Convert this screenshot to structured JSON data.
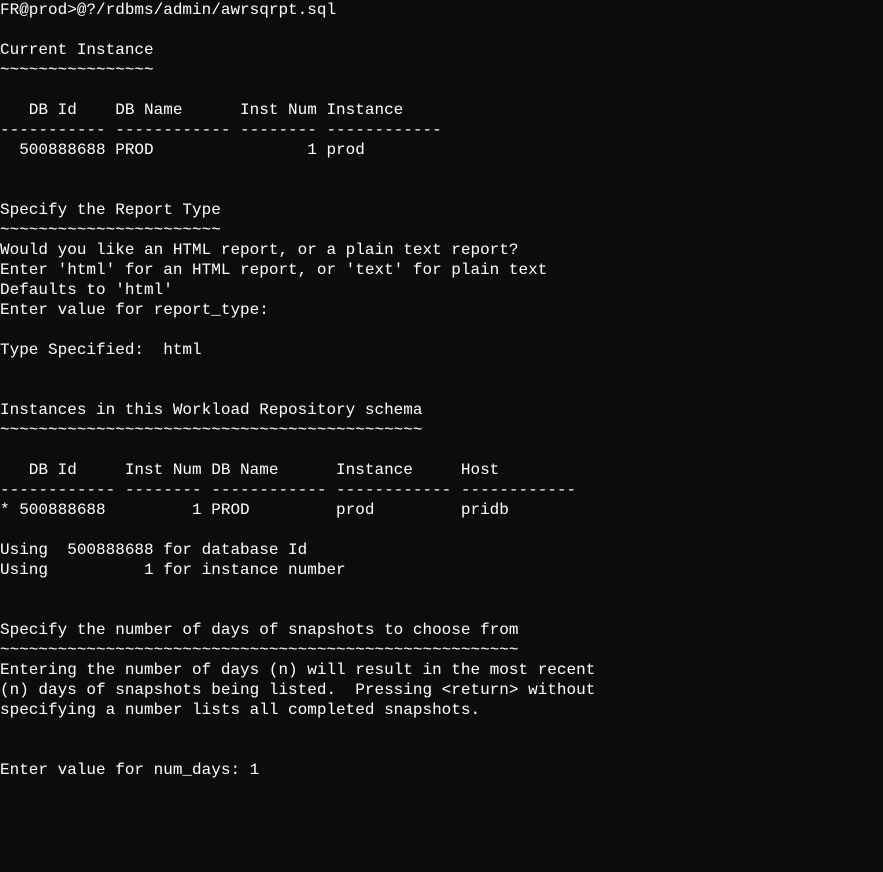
{
  "prompt": "FR@prod>@?/rdbms/admin/awrsqrpt.sql",
  "section1_title": "Current Instance",
  "section1_underline": "~~~~~~~~~~~~~~~~",
  "table1_header": "   DB Id    DB Name      Inst Num Instance",
  "table1_divider": "----------- ------------ -------- ------------",
  "table1_row": "  500888688 PROD                1 prod",
  "section2_title": "Specify the Report Type",
  "section2_underline": "~~~~~~~~~~~~~~~~~~~~~~~",
  "report_q1": "Would you like an HTML report, or a plain text report?",
  "report_q2": "Enter 'html' for an HTML report, or 'text' for plain text",
  "report_q3": "Defaults to 'html'",
  "report_prompt": "Enter value for report_type:",
  "type_specified": "Type Specified:  html",
  "section3_title": "Instances in this Workload Repository schema",
  "section3_underline": "~~~~~~~~~~~~~~~~~~~~~~~~~~~~~~~~~~~~~~~~~~~~",
  "table2_header": "   DB Id     Inst Num DB Name      Instance     Host",
  "table2_divider": "------------ -------- ------------ ------------ ------------",
  "table2_row": "* 500888688         1 PROD         prod         pridb",
  "using_db": "Using  500888688 for database Id",
  "using_inst": "Using          1 for instance number",
  "section4_title": "Specify the number of days of snapshots to choose from",
  "section4_underline": "~~~~~~~~~~~~~~~~~~~~~~~~~~~~~~~~~~~~~~~~~~~~~~~~~~~~~~",
  "days_p1": "Entering the number of days (n) will result in the most recent",
  "days_p2": "(n) days of snapshots being listed.  Pressing <return> without",
  "days_p3": "specifying a number lists all completed snapshots.",
  "num_days_prompt": "Enter value for num_days: 1"
}
